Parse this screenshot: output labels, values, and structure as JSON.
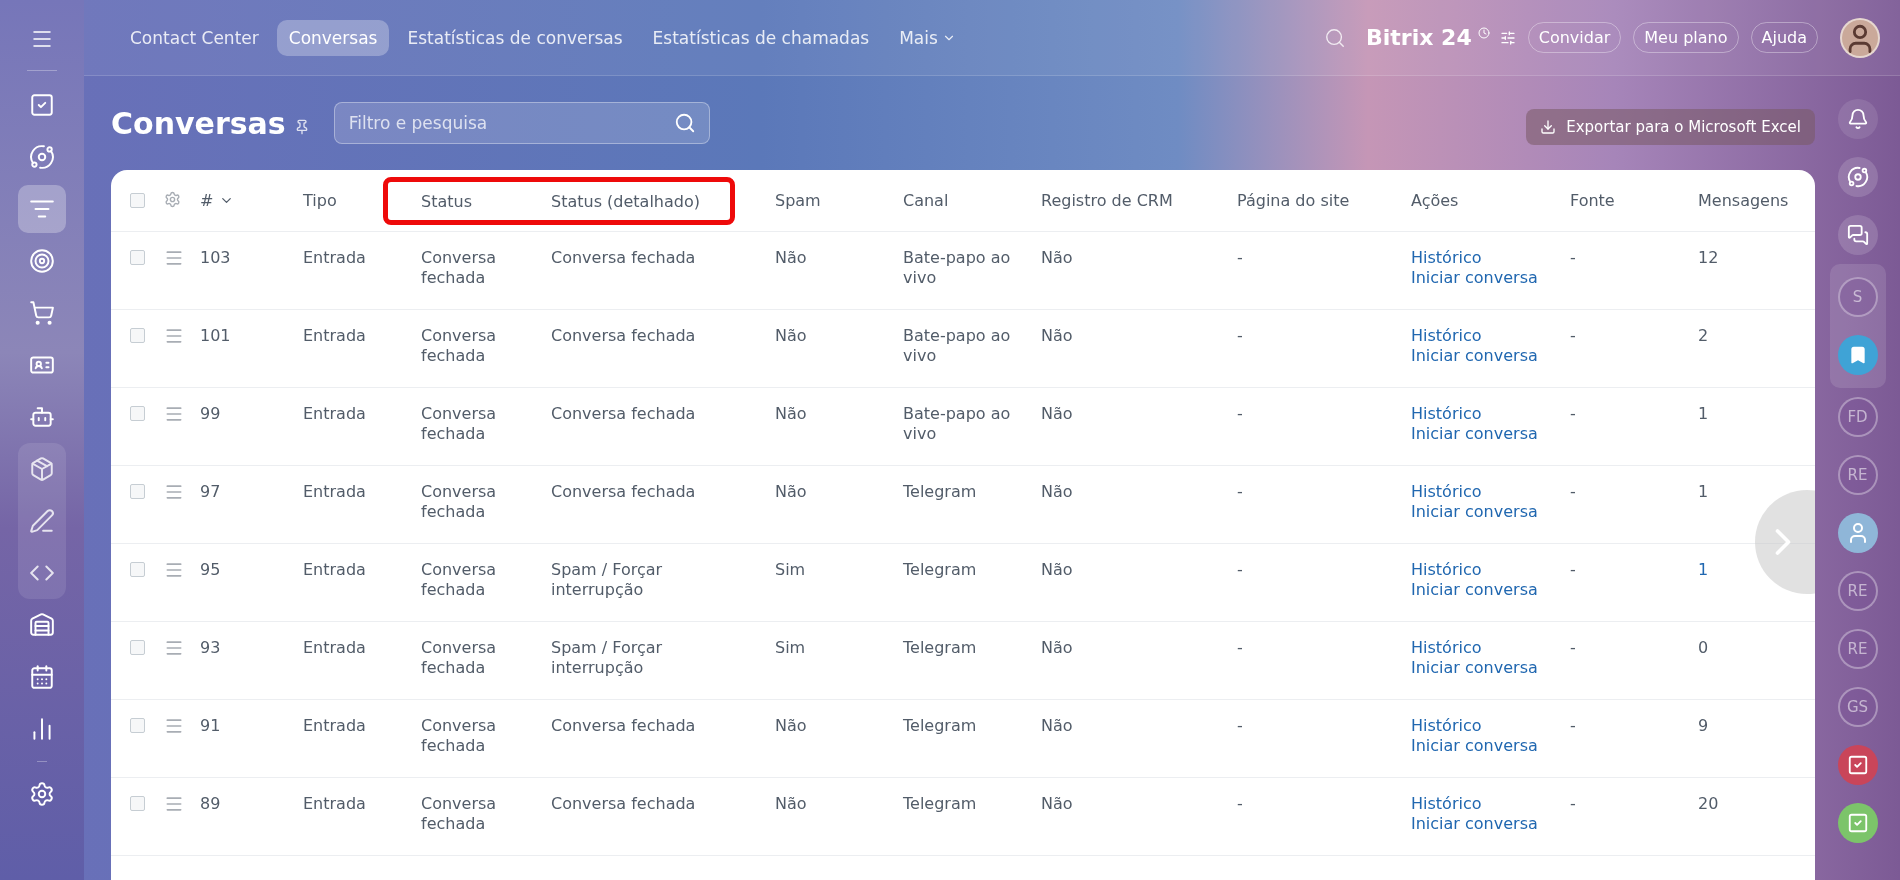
{
  "left_sidebar": {
    "items": [
      {
        "selected": false,
        "grouped": false
      },
      {
        "selected": false,
        "grouped": false
      },
      {
        "selected": true,
        "grouped": false
      },
      {
        "selected": false,
        "grouped": false
      },
      {
        "selected": false,
        "grouped": false
      },
      {
        "selected": false,
        "grouped": false
      },
      {
        "selected": false,
        "grouped": false
      },
      {
        "selected": false,
        "grouped": true
      },
      {
        "selected": false,
        "grouped": true
      },
      {
        "selected": false,
        "grouped": true
      },
      {
        "selected": false,
        "grouped": false
      },
      {
        "selected": false,
        "grouped": false
      },
      {
        "selected": false,
        "grouped": false
      },
      {
        "selected": false,
        "grouped": false
      }
    ]
  },
  "top_nav": {
    "tabs": [
      {
        "label": "Contact Center",
        "selected": false
      },
      {
        "label": "Conversas",
        "selected": true
      },
      {
        "label": "Estatísticas de conversas",
        "selected": false
      },
      {
        "label": "Estatísticas de chamadas",
        "selected": false
      },
      {
        "label": "Mais",
        "selected": false
      }
    ],
    "logo": "Bitrix",
    "logo_number": "24",
    "buttons": [
      "Convidar",
      "Meu plano",
      "Ajuda"
    ]
  },
  "page": {
    "title": "Conversas",
    "search": {
      "placeholder": "Filtro e pesquisa"
    },
    "export_button": "Exportar para o Microsoft Excel"
  },
  "table": {
    "select_all_checked": false,
    "columns": [
      {
        "label": "#",
        "highlighted": false
      },
      {
        "label": "Tipo",
        "highlighted": false
      },
      {
        "label": "Status",
        "highlighted": true
      },
      {
        "label": "Status (detalhado)",
        "highlighted": true
      },
      {
        "label": "Spam",
        "highlighted": false
      },
      {
        "label": "Canal",
        "highlighted": false
      },
      {
        "label": "Registro de CRM",
        "highlighted": false
      },
      {
        "label": "Página do site",
        "highlighted": false
      },
      {
        "label": "Ações",
        "highlighted": false
      },
      {
        "label": "Fonte",
        "highlighted": false
      },
      {
        "label": "Mensagens",
        "highlighted": false
      }
    ],
    "rows": [
      {
        "checked": false,
        "id": "103",
        "tipo": "Entrada",
        "status": "Conversa fechada",
        "status_detail": "Conversa fechada",
        "spam": "Não",
        "canal": "Bate-papo ao vivo",
        "crm": "Não",
        "pagina": "-",
        "actions": [
          "Histórico",
          "Iniciar conversa"
        ],
        "fonte": "-",
        "mensagens": "12",
        "mensagens_link": false
      },
      {
        "checked": false,
        "id": "101",
        "tipo": "Entrada",
        "status": "Conversa fechada",
        "status_detail": "Conversa fechada",
        "spam": "Não",
        "canal": "Bate-papo ao vivo",
        "crm": "Não",
        "pagina": "-",
        "actions": [
          "Histórico",
          "Iniciar conversa"
        ],
        "fonte": "-",
        "mensagens": "2",
        "mensagens_link": false
      },
      {
        "checked": false,
        "id": "99",
        "tipo": "Entrada",
        "status": "Conversa fechada",
        "status_detail": "Conversa fechada",
        "spam": "Não",
        "canal": "Bate-papo ao vivo",
        "crm": "Não",
        "pagina": "-",
        "actions": [
          "Histórico",
          "Iniciar conversa"
        ],
        "fonte": "-",
        "mensagens": "1",
        "mensagens_link": false
      },
      {
        "checked": false,
        "id": "97",
        "tipo": "Entrada",
        "status": "Conversa fechada",
        "status_detail": "Conversa fechada",
        "spam": "Não",
        "canal": "Telegram",
        "crm": "Não",
        "pagina": "-",
        "actions": [
          "Histórico",
          "Iniciar conversa"
        ],
        "fonte": "-",
        "mensagens": "1",
        "mensagens_link": false
      },
      {
        "checked": false,
        "id": "95",
        "tipo": "Entrada",
        "status": "Conversa fechada",
        "status_detail": "Spam / Forçar interrupção",
        "spam": "Sim",
        "canal": "Telegram",
        "crm": "Não",
        "pagina": "-",
        "actions": [
          "Histórico",
          "Iniciar conversa"
        ],
        "fonte": "-",
        "mensagens": "1",
        "mensagens_link": true
      },
      {
        "checked": false,
        "id": "93",
        "tipo": "Entrada",
        "status": "Conversa fechada",
        "status_detail": "Spam / Forçar interrupção",
        "spam": "Sim",
        "canal": "Telegram",
        "crm": "Não",
        "pagina": "-",
        "actions": [
          "Histórico",
          "Iniciar conversa"
        ],
        "fonte": "-",
        "mensagens": "0",
        "mensagens_link": false
      },
      {
        "checked": false,
        "id": "91",
        "tipo": "Entrada",
        "status": "Conversa fechada",
        "status_detail": "Conversa fechada",
        "spam": "Não",
        "canal": "Telegram",
        "crm": "Não",
        "pagina": "-",
        "actions": [
          "Histórico",
          "Iniciar conversa"
        ],
        "fonte": "-",
        "mensagens": "9",
        "mensagens_link": false
      },
      {
        "checked": false,
        "id": "89",
        "tipo": "Entrada",
        "status": "Conversa fechada",
        "status_detail": "Conversa fechada",
        "spam": "Não",
        "canal": "Telegram",
        "crm": "Não",
        "pagina": "-",
        "actions": [
          "Histórico",
          "Iniciar conversa"
        ],
        "fonte": "-",
        "mensagens": "20",
        "mensagens_link": false
      }
    ]
  },
  "right_rail": {
    "items": [
      {
        "kind": "bell",
        "grouped": false
      },
      {
        "kind": "copilot",
        "grouped": false
      },
      {
        "kind": "chat",
        "grouped": false
      },
      {
        "kind": "initials",
        "text": "S",
        "grouped": true
      },
      {
        "kind": "bookmark",
        "grouped": true,
        "color": "#3fa3d6"
      },
      {
        "kind": "initials",
        "text": "FD",
        "grouped": false
      },
      {
        "kind": "initials",
        "text": "RE",
        "grouped": false
      },
      {
        "kind": "avatar",
        "grouped": false
      },
      {
        "kind": "initials",
        "text": "RE",
        "grouped": false
      },
      {
        "kind": "initials",
        "text": "RE",
        "grouped": false
      },
      {
        "kind": "initials",
        "text": "GS",
        "grouped": false
      },
      {
        "kind": "task",
        "grouped": false,
        "color": "#c9455a"
      },
      {
        "kind": "task",
        "grouped": false,
        "color": "#7cc46a"
      }
    ]
  }
}
